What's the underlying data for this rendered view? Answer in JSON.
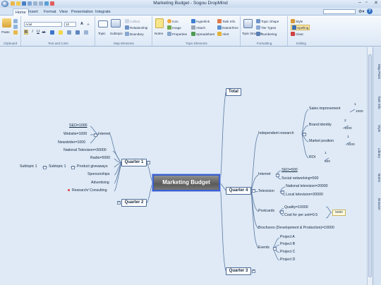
{
  "window": {
    "title": "Marketing Budget - Sogou DropMind"
  },
  "menu": {
    "tabs": [
      "Home",
      "Insert",
      "Format",
      "View",
      "Presentation",
      "Integrate"
    ],
    "active": "Home"
  },
  "ribbon": {
    "clipboard": {
      "label": "Clipboard",
      "paste": "Paste"
    },
    "text_color": {
      "label": "Text and Color",
      "font": "Arial",
      "size": "10",
      "grow": "A",
      "shrink": "A"
    },
    "map_elements": {
      "label": "Map Elements",
      "topic": "Topic",
      "subtopic": "Subtopic",
      "callout": "Callout",
      "relationship": "Relationship",
      "boundary": "Boundary"
    },
    "topic_elements": {
      "label": "Topic Elements",
      "notes": "Notes",
      "icon": "Icon",
      "image": "Image",
      "properties": "Properties",
      "hyperlink": "Hyperlink",
      "attach": "Attach",
      "spreadsheet": "Spreadsheet",
      "task_info": "Task Info",
      "datetime": "Date&Time",
      "alert": "Alert"
    },
    "formatting": {
      "label": "Formatting",
      "topic_shape": "Topic Shape",
      "tier_types": "Tier Types",
      "numbering": "Numbering",
      "structure": "Topic Structure"
    },
    "editing": {
      "label": "Editing",
      "style": "Style",
      "spelling": "Spelling",
      "clear": "Clear"
    }
  },
  "side_tabs": [
    "Map Parts",
    "Task Info",
    "Style",
    "Library",
    "Notes",
    "Browser"
  ],
  "map": {
    "central": "Marketing Budget",
    "quarters": {
      "q1": "Quarter 1",
      "q2": "Quarter 2",
      "q3": "Quarter 3",
      "q4": "Quarter 4",
      "total": "Total"
    },
    "q1": {
      "internet": "Internet",
      "internet_items": [
        "SEO=1000",
        "Website=1000",
        "Newsletter=1000"
      ],
      "national_tv": "National Television=30000",
      "radio": "Radio=5000",
      "product_giveaways": "Product giveaways",
      "subtopic_a": "Subtopic 1",
      "subtopic_b": "Subtopic 1",
      "sponsorships": "Sponsorships",
      "advertising": "Advertising",
      "research": "Research/ Consulting"
    },
    "q4": {
      "independent_research": "Independent research",
      "sales_improvement": "Sales improvement",
      "sales_nums": [
        "1",
        "1000"
      ],
      "brand_identity": "Brand identity",
      "brand_nums": [
        "2",
        "1000"
      ],
      "market_position": "Market position",
      "market_nums": [
        "1",
        "1000"
      ],
      "roi": "ROI",
      "roi_nums": [
        "1",
        "500"
      ],
      "internet": "Internet",
      "seo": "SEO=500",
      "social": "Social networking=500",
      "television": "Television",
      "national_tv": "National television=20000",
      "local_tv": "Local television=20000",
      "postcards": "Postcards",
      "quality": "Quality=10000",
      "cost_per_unit": "Cost for per unit=0.5",
      "postcards_total": "5000",
      "brochures": "Brochures (Development & Production)=10000",
      "events": "Events",
      "projects": [
        "Project A",
        "Project B",
        "Project C",
        "Project D"
      ]
    }
  }
}
